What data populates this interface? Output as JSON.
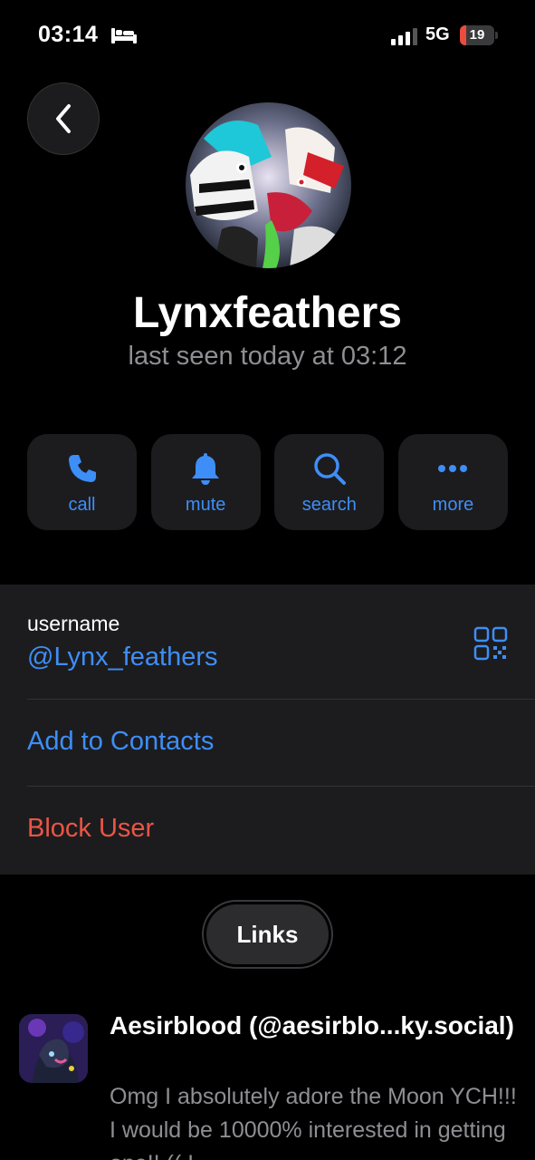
{
  "status_bar": {
    "time": "03:14",
    "network": "5G",
    "battery_percent": "19",
    "battery_level": 0.19,
    "icons": [
      "bed-icon",
      "signal-icon",
      "battery-icon"
    ]
  },
  "profile": {
    "name": "Lynxfeathers",
    "last_seen": "last seen today at 03:12"
  },
  "actions": [
    {
      "label": "call",
      "icon": "phone-icon"
    },
    {
      "label": "mute",
      "icon": "bell-icon"
    },
    {
      "label": "search",
      "icon": "search-icon"
    },
    {
      "label": "more",
      "icon": "more-icon"
    }
  ],
  "info": {
    "username_caption": "username",
    "username_value": "@Lynx_feathers",
    "add_contacts": "Add to Contacts",
    "block_user": "Block User"
  },
  "links_tab": {
    "label": "Links"
  },
  "link_preview": {
    "title": "Aesirblood (@aesirblo...ky.social)",
    "description": "Omg I absolutely adore the Moon YCH!!! I would be 10000% interested in getting one!! (( I"
  },
  "colors": {
    "accent": "#3e8ef7",
    "destructive": "#eb5545",
    "background": "#000000",
    "card": "#1c1c1e",
    "secondary_text": "#8e8e93"
  }
}
